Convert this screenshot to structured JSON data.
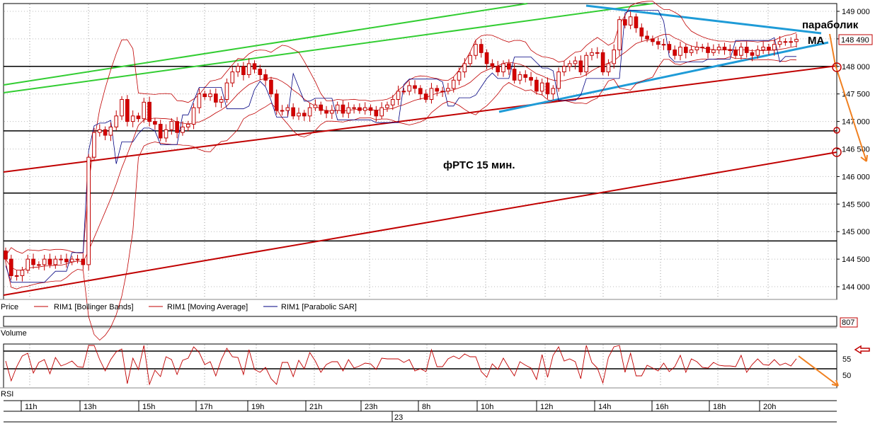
{
  "chart_data": {
    "type": "candlestick",
    "instrument": "фРТС",
    "timeframe": "15 мин.",
    "annotation": "фРТС   15 мин.",
    "labels": {
      "parabolic": "параболик",
      "ma": "МА"
    },
    "price_panel": {
      "title": "Price",
      "legend": [
        "RIM1 [Bollinger Bands]",
        "RIM1 [Moving Average]",
        "RIM1 [Parabolic SAR]"
      ],
      "ylim": [
        143800,
        149100
      ],
      "yticks": [
        {
          "v": 149000,
          "t": "149 000"
        },
        {
          "v": 148500,
          "t": "148 500"
        },
        {
          "v": 148000,
          "t": "148 000"
        },
        {
          "v": 147500,
          "t": "147 500"
        },
        {
          "v": 147000,
          "t": "147 000"
        },
        {
          "v": 146500,
          "t": "146 500"
        },
        {
          "v": 146000,
          "t": "146 000"
        },
        {
          "v": 145500,
          "t": "145 500"
        },
        {
          "v": 145000,
          "t": "145 000"
        },
        {
          "v": 144500,
          "t": "144 500"
        },
        {
          "v": 144000,
          "t": "144 000"
        }
      ],
      "current_price": "148 490",
      "current_price_value": 148490
    },
    "volume_panel": {
      "title": "Volume",
      "value_label": "807"
    },
    "rsi_panel": {
      "title": "RSI",
      "yticks": [
        "55",
        "50"
      ]
    },
    "x_labels": [
      "11h",
      "13h",
      "15h",
      "17h",
      "19h",
      "21h",
      "23h",
      "8h",
      "10h",
      "12h",
      "14h",
      "16h",
      "18h",
      "20h"
    ],
    "date_label": "23",
    "horizontal_levels": [
      148000,
      146830,
      145700,
      144830
    ],
    "closes": [
      144500,
      144200,
      144200,
      144300,
      144500,
      144400,
      144400,
      144500,
      144400,
      144500,
      144500,
      144450,
      144500,
      144500,
      144400,
      146350,
      146800,
      146850,
      146750,
      146900,
      147100,
      147400,
      147000,
      147100,
      147050,
      147350,
      147000,
      146950,
      146700,
      146850,
      147000,
      146800,
      146900,
      146950,
      147250,
      147500,
      147450,
      147500,
      147350,
      147400,
      147700,
      147900,
      148000,
      147850,
      148050,
      147950,
      147850,
      147750,
      147500,
      147200,
      147200,
      147250,
      147100,
      147150,
      147100,
      147250,
      147300,
      147200,
      147150,
      147200,
      147300,
      147150,
      147250,
      147250,
      147200,
      147250,
      147200,
      147100,
      147250,
      147300,
      147400,
      147550,
      147550,
      147650,
      147600,
      147500,
      147400,
      147600,
      147550,
      147550,
      147600,
      147750,
      147900,
      148050,
      148200,
      148400,
      148250,
      148050,
      148000,
      147900,
      148050,
      147950,
      147750,
      147850,
      147800,
      147750,
      147550,
      147700,
      147500,
      147600,
      147900,
      148000,
      148050,
      148100,
      147900,
      148200,
      148250,
      148250,
      147900,
      148050,
      148300,
      148850,
      148750,
      148900,
      148700,
      148550,
      148500,
      148450,
      148400,
      148400,
      148300,
      148200,
      148350,
      148250,
      148300,
      148350,
      148350,
      148250,
      148300,
      148350,
      148300,
      148300,
      148200,
      148350,
      148250,
      148200,
      148300,
      148350,
      148300,
      148400,
      148450,
      148450,
      148450,
      148490
    ]
  }
}
